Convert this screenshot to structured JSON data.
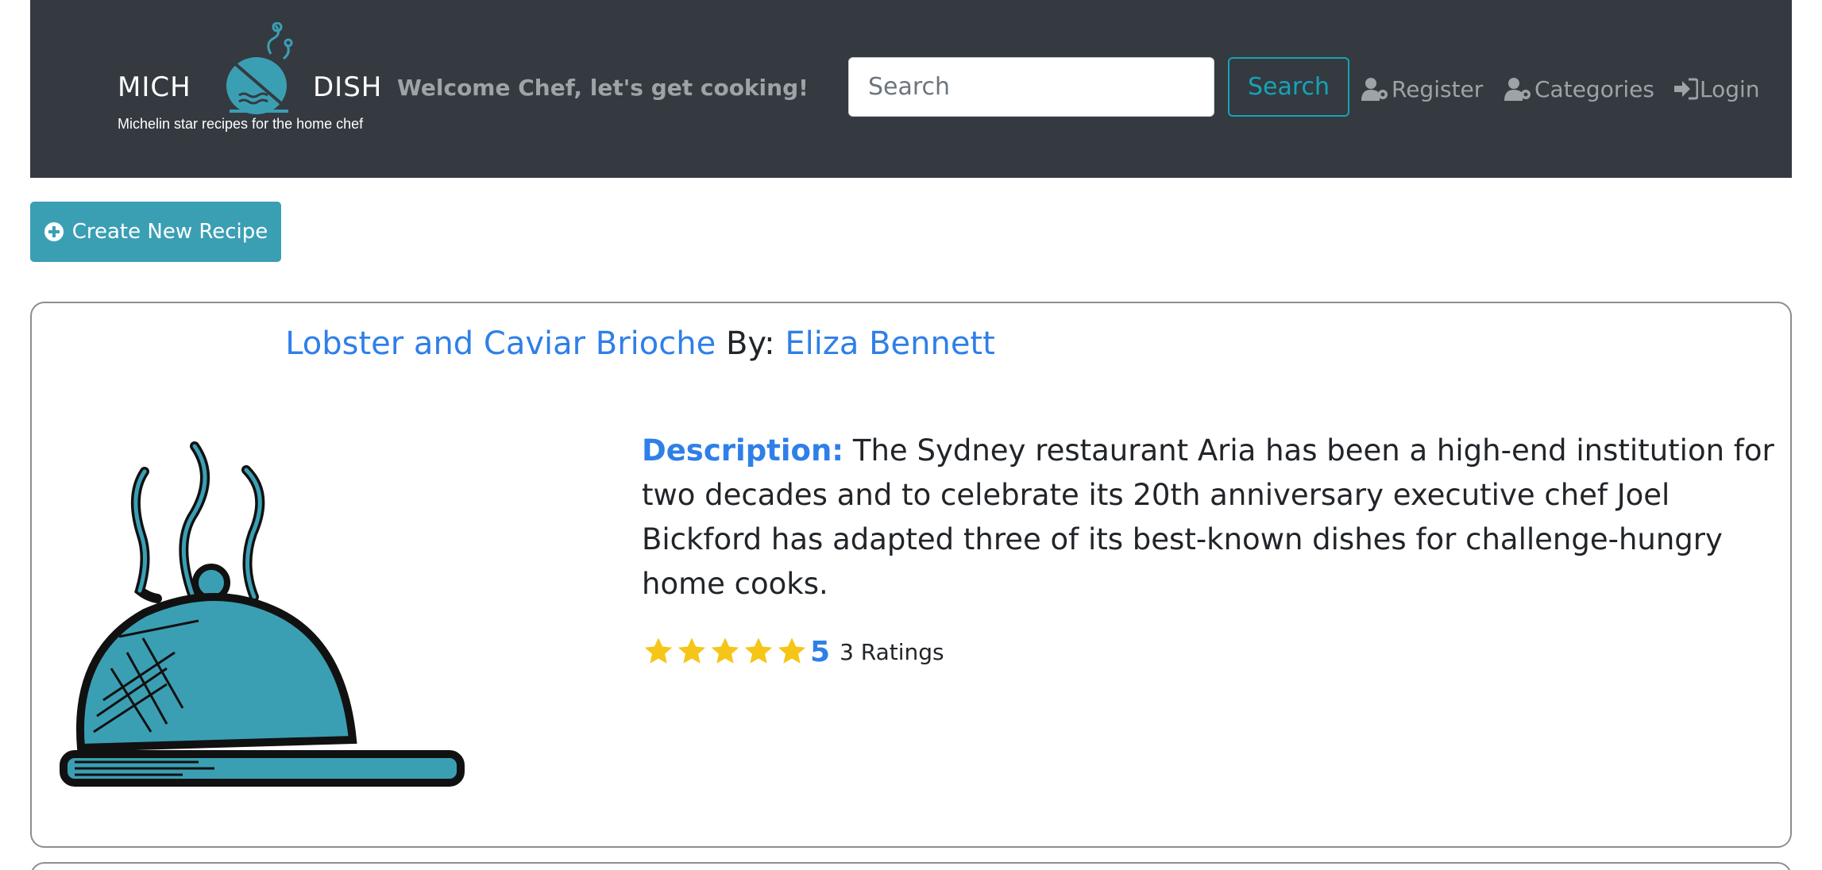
{
  "navbar": {
    "logo_left": "MICH",
    "logo_right": "DISH",
    "tagline": "Michelin star recipes for the home chef",
    "welcome": "Welcome Chef, let's get cooking!",
    "search_placeholder": "Search",
    "search_button": "Search",
    "links": {
      "register": "Register",
      "categories": "Categories",
      "login": "Login"
    },
    "background_color": "#343a40",
    "accent_color": "#17a2b8"
  },
  "create_button": {
    "label": "Create New Recipe",
    "icon": "plus-circle-icon",
    "color": "#3b9fb4"
  },
  "recipe": {
    "title": "Lobster and Caviar Brioche",
    "by_label": "By:",
    "author": "Eliza Bennett",
    "description_label": "Description:",
    "description": "The Sydney restaurant Aria has been a high-end institution for two decades and to celebrate its 20th anniversary executive chef Joel Bickford has adapted three of its best-known dishes for challenge-hungry home cooks.",
    "rating_value": "5",
    "rating_stars": 5,
    "rating_count": "3 Ratings",
    "image": "cloche-icon",
    "link_color": "#2f7fe8",
    "star_color": "#f5c518"
  }
}
